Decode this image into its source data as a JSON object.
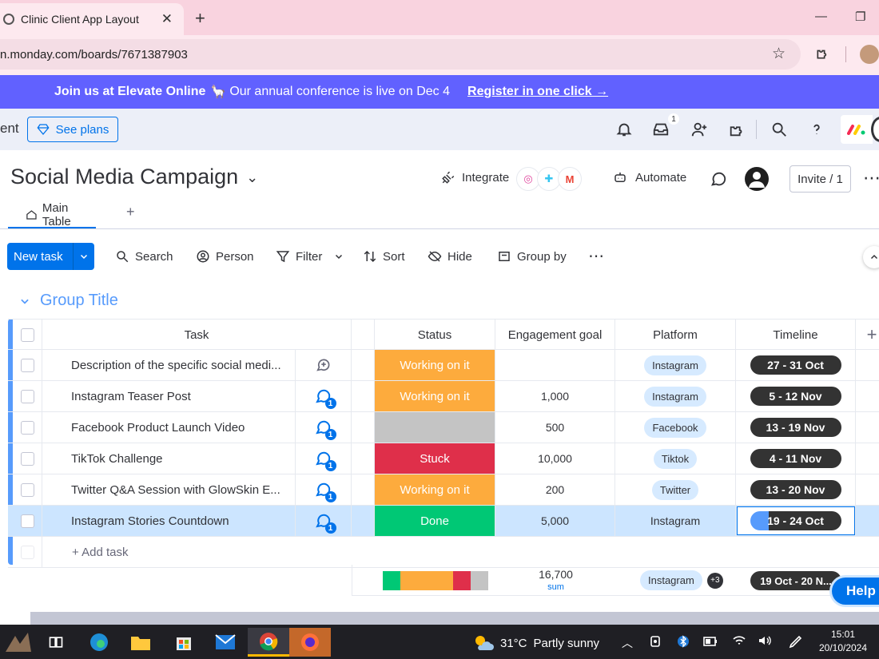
{
  "browser": {
    "tab_title": "Clinic Client App Layout",
    "url": "n.monday.com/boards/7671387903",
    "colors": {
      "tabbar": "#f9d3df",
      "addrbar": "#fde9ef"
    }
  },
  "banner": {
    "bold": "Join us at Elevate Online",
    "llama": "🦙",
    "text": "Our annual conference is live on Dec 4",
    "link": "Register in one click →"
  },
  "topnav": {
    "brand_cut": "ent",
    "see_plans": "See plans",
    "inbox_badge": "1",
    "icons": [
      "bell-icon",
      "inbox-icon",
      "invite-members-icon",
      "apps-icon",
      "search-icon",
      "help-icon"
    ]
  },
  "board": {
    "title": "Social Media Campaign",
    "integrate": "Integrate",
    "automate": "Automate",
    "invite": "Invite / 1",
    "view_tab": "Main Table"
  },
  "toolbar": {
    "new_task": "New task",
    "search": "Search",
    "person": "Person",
    "filter": "Filter",
    "sort": "Sort",
    "hide": "Hide",
    "group_by": "Group by"
  },
  "group": {
    "title": "Group Title",
    "color": "#579bfc",
    "columns": {
      "task": "Task",
      "status": "Status",
      "engagement": "Engagement goal",
      "platform": "Platform",
      "timeline": "Timeline"
    },
    "rows": [
      {
        "task": "Description of the specific social medi...",
        "updates": "",
        "status": "Working on it",
        "status_color": "#fdab3d",
        "engagement": "",
        "platform": "Instagram",
        "timeline": "27 - 31 Oct"
      },
      {
        "task": "Instagram Teaser Post",
        "updates": "1",
        "status": "Working on it",
        "status_color": "#fdab3d",
        "engagement": "1,000",
        "platform": "Instagram",
        "timeline": "5 - 12 Nov"
      },
      {
        "task": "Facebook Product Launch Video",
        "updates": "1",
        "status": "",
        "status_color": "#c4c4c4",
        "engagement": "500",
        "platform": "Facebook",
        "timeline": "13 - 19 Nov"
      },
      {
        "task": "TikTok Challenge",
        "updates": "1",
        "status": "Stuck",
        "status_color": "#df2f4a",
        "engagement": "10,000",
        "platform": "Tiktok",
        "timeline": "4 - 11 Nov"
      },
      {
        "task": "Twitter Q&A Session with GlowSkin E...",
        "updates": "1",
        "status": "Working on it",
        "status_color": "#fdab3d",
        "engagement": "200",
        "platform": "Twitter",
        "timeline": "13 - 20 Nov"
      },
      {
        "task": "Instagram Stories Countdown",
        "updates": "1",
        "status": "Done",
        "status_color": "#00c875",
        "engagement": "5,000",
        "platform": "Instagram",
        "timeline": "19 - 24 Oct"
      }
    ],
    "add_task": "+ Add task",
    "summary": {
      "engagement_total": "16,700",
      "engagement_unit": "sum",
      "platform": "Instagram",
      "platform_more": "+3",
      "timeline": "19 Oct - 20 N...",
      "status_distribution": [
        {
          "color": "#00c875",
          "share": 1
        },
        {
          "color": "#fdab3d",
          "share": 3
        },
        {
          "color": "#df2f4a",
          "share": 1
        },
        {
          "color": "#c4c4c4",
          "share": 1
        }
      ]
    }
  },
  "help": "Help",
  "taskbar": {
    "weather_temp": "31°C",
    "weather_text": "Partly sunny",
    "time": "15:01",
    "date": "20/10/2024"
  }
}
